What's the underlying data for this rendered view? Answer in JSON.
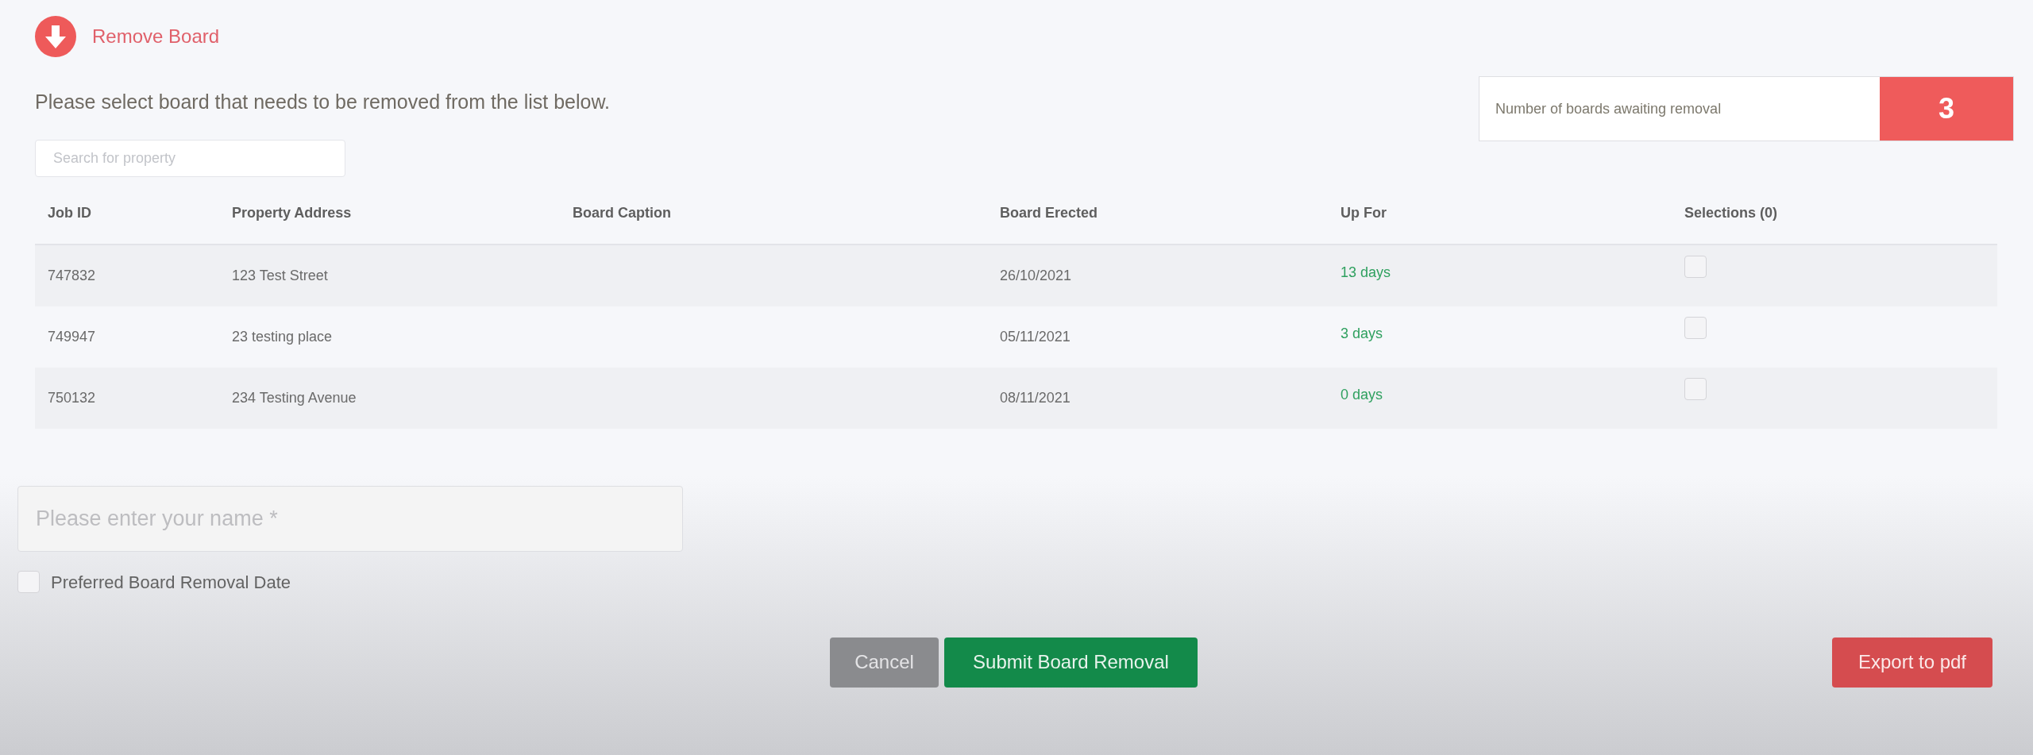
{
  "header": {
    "title": "Remove Board"
  },
  "instruction": "Please select board that needs to be removed from the list below.",
  "counter": {
    "label": "Number of boards awaiting removal",
    "value": "3"
  },
  "search": {
    "placeholder": "Search for property"
  },
  "table": {
    "columns": [
      "Job ID",
      "Property Address",
      "Board Caption",
      "Board Erected",
      "Up For",
      "Selections (0)"
    ],
    "rows": [
      {
        "job_id": "747832",
        "address": "123 Test Street",
        "erected": "26/10/2021",
        "up_for": "13 days",
        "selected": false
      },
      {
        "job_id": "749947",
        "address": "23 testing place",
        "erected": "05/11/2021",
        "up_for": "3 days",
        "selected": false
      },
      {
        "job_id": "750132",
        "address": "234 Testing Avenue",
        "erected": "08/11/2021",
        "up_for": "0 days",
        "selected": false
      }
    ]
  },
  "name_field": {
    "placeholder": "Please enter your name *"
  },
  "preferred_date": {
    "label": "Preferred Board Removal Date",
    "checked": false
  },
  "buttons": [
    {
      "label": "Cancel",
      "kind": "cancel"
    },
    {
      "label": "Submit Board Removal",
      "kind": "submit"
    },
    {
      "label": "Export to pdf",
      "kind": "export"
    }
  ]
}
